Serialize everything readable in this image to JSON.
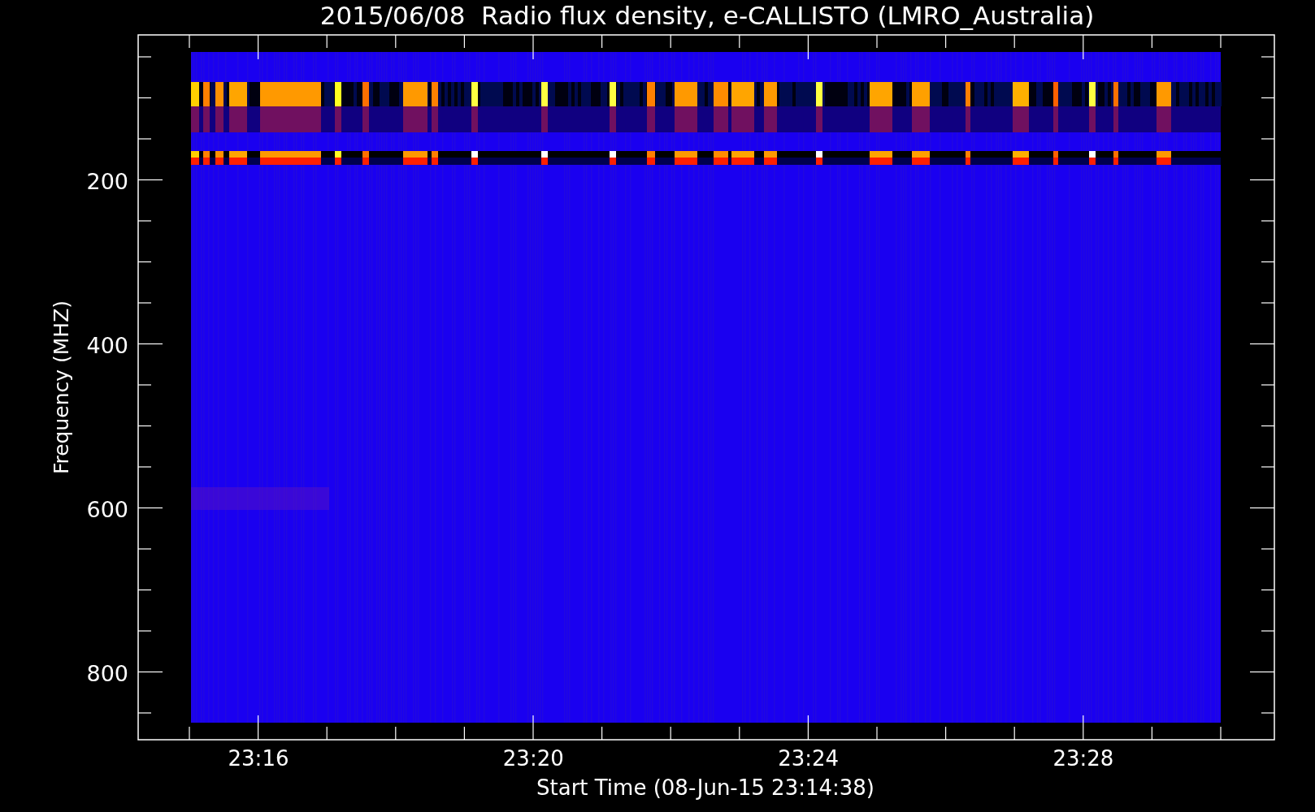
{
  "title": "2015/06/08  Radio flux density, e-CALLISTO (LMRO_Australia)",
  "ylabel": "Frequency (MHZ)",
  "xlabel": "Start Time (08-Jun-15 23:14:38)",
  "yticks": [
    "200",
    "400",
    "600",
    "800"
  ],
  "xticks": [
    "23:16",
    "23:20",
    "23:24",
    "23:28"
  ]
}
